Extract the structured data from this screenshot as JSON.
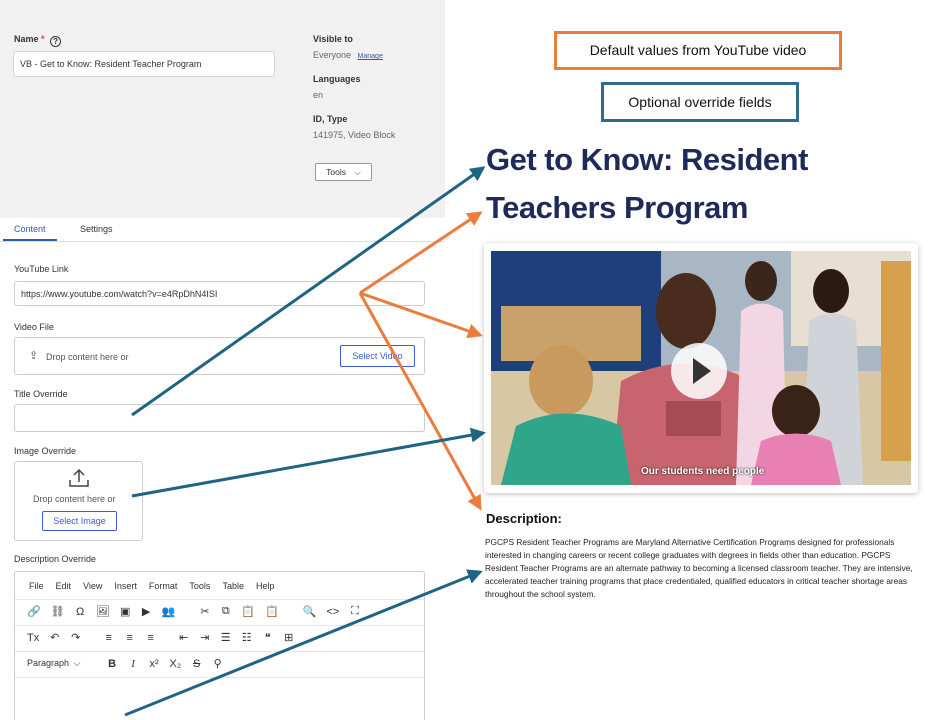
{
  "form": {
    "name_label": "Name",
    "required_mark": "*",
    "help_glyph": "?",
    "name_value": "VB - Get to Know: Resident Teacher Program",
    "visible_to_label": "Visible to",
    "visible_to_value": "Everyone",
    "manage_link": "Manage",
    "languages_label": "Languages",
    "languages_value": "en",
    "id_type_label": "ID, Type",
    "id_type_value": "141975, Video Block",
    "tools_label": "Tools",
    "tools_caret": "⌵",
    "tabs": [
      "Content",
      "Settings"
    ],
    "youtube_label": "YouTube Link",
    "youtube_value": "https://www.youtube.com/watch?v=e4RpDhN4ISI",
    "video_file_label": "Video File",
    "video_drop_text": "Drop content here or",
    "select_video_label": "Select Video",
    "title_override_label": "Title Override",
    "title_override_value": "",
    "image_override_label": "Image Override",
    "image_drop_text": "Drop content here or",
    "select_image_label": "Select Image",
    "description_override_label": "Description Override"
  },
  "editor": {
    "menu": [
      "File",
      "Edit",
      "View",
      "Insert",
      "Format",
      "Tools",
      "Table",
      "Help"
    ],
    "row1_icons": [
      "🔗",
      "⛓",
      "Ω",
      "🖼",
      "▣",
      "▶",
      "👥",
      "✂",
      "⧉",
      "📋",
      "📋",
      "🔍",
      "<>",
      "⛶"
    ],
    "row2_icons": [
      "Tx",
      "↶",
      "↷",
      "≡",
      "≡",
      "≡",
      "⇤",
      "⇥",
      "☰",
      "☷",
      "❝",
      "⊞"
    ],
    "paragraph_label": "Paragraph",
    "paragraph_caret": "⌵",
    "row3_icons": [
      "B",
      "I",
      "x²",
      "X₂",
      "S",
      "⚲"
    ]
  },
  "preview": {
    "legend_default": "Default values from YouTube video",
    "legend_override": "Optional override fields",
    "title": "Get to Know: Resident Teachers Program",
    "video_caption": "Our students need people",
    "description_heading": "Description:",
    "description_text": "PGCPS Resident Teacher Programs are Maryland Alternative Certification Programs designed for professionals interested in changing careers or recent college graduates with degrees in fields other than education. PGCPS Resident Teacher Programs are an alternate pathway to becoming a licensed classroom teacher. They are intensive, accelerated teacher training programs that place credentialed, qualified educators in critical teacher shortage areas throughout the school system."
  },
  "colors": {
    "orange_arrow": "#e87d3e",
    "blue_arrow": "#1f6482",
    "title_navy": "#1e2a5a",
    "link_blue": "#3b5bdb"
  }
}
